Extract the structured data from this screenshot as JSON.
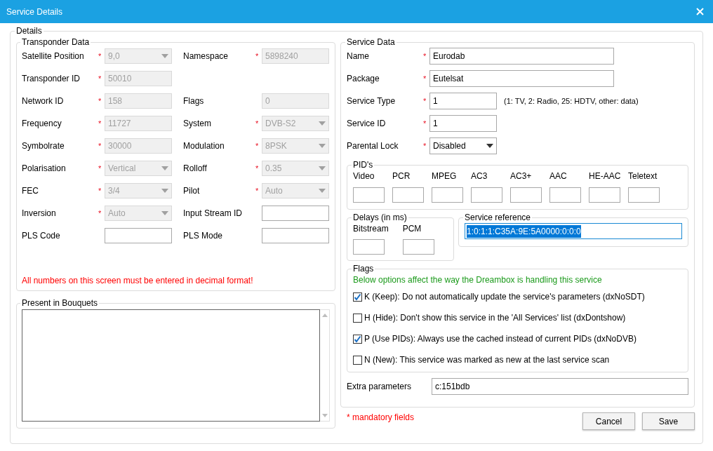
{
  "window": {
    "title": "Service Details"
  },
  "details": {
    "title": "Details",
    "transponder": {
      "title": "Transponder Data",
      "rows": [
        {
          "left": {
            "label": "Satellite Position",
            "required_mark": "*",
            "kind": "dropdown",
            "value": "9,0",
            "disabled": true
          },
          "right": {
            "label": "Namespace",
            "required_mark": "*",
            "kind": "text",
            "value": "5898240",
            "disabled": true
          }
        },
        {
          "left": {
            "label": "Transponder ID",
            "required_mark": "*",
            "kind": "text",
            "value": "50010",
            "disabled": true
          }
        },
        {
          "left": {
            "label": "Network ID",
            "required_mark": "*",
            "kind": "text",
            "value": "158",
            "disabled": true
          },
          "right": {
            "label": "Flags",
            "kind": "text",
            "value": "0",
            "disabled": true
          }
        },
        {
          "left": {
            "label": "Frequency",
            "required_mark": "*",
            "kind": "text",
            "value": "11727",
            "disabled": true
          },
          "right": {
            "label": "System",
            "required_mark": "*",
            "kind": "dropdown",
            "value": "DVB-S2",
            "disabled": true
          }
        },
        {
          "left": {
            "label": "Symbolrate",
            "required_mark": "*",
            "kind": "text",
            "value": "30000",
            "disabled": true
          },
          "right": {
            "label": "Modulation",
            "required_mark": "*",
            "kind": "dropdown",
            "value": "8PSK",
            "disabled": true
          }
        },
        {
          "left": {
            "label": "Polarisation",
            "required_mark": "*",
            "kind": "dropdown",
            "value": "Vertical",
            "disabled": true
          },
          "right": {
            "label": "Rolloff",
            "required_mark": "*",
            "kind": "dropdown",
            "value": "0.35",
            "disabled": true
          }
        },
        {
          "left": {
            "label": "FEC",
            "required_mark": "*",
            "kind": "dropdown",
            "value": "3/4",
            "disabled": true
          },
          "right": {
            "label": "Pilot",
            "required_mark": "*",
            "kind": "dropdown",
            "value": "Auto",
            "disabled": true
          }
        },
        {
          "left": {
            "label": "Inversion",
            "required_mark": "*",
            "kind": "dropdown",
            "value": "Auto",
            "disabled": true
          },
          "right": {
            "label": "Input Stream ID",
            "kind": "text",
            "disabled": false
          }
        },
        {
          "left": {
            "label": "PLS Code",
            "kind": "text",
            "disabled": false
          },
          "right": {
            "label": "PLS Mode",
            "kind": "text",
            "disabled": false
          }
        }
      ],
      "note": "All numbers on this screen must be entered in decimal format!"
    },
    "bouquets": {
      "title": "Present in Bouquets"
    },
    "service": {
      "title": "Service Data",
      "fields": [
        {
          "label": "Name",
          "required_mark": "*",
          "kind": "long_text",
          "value": "Eurodab"
        },
        {
          "label": "Package",
          "required_mark": "*",
          "kind": "long_text",
          "value": "Eutelsat"
        },
        {
          "label": "Service Type",
          "required_mark": "*",
          "kind": "text",
          "value": "1",
          "hint": "(1: TV, 2: Radio, 25: HDTV, other: data)"
        },
        {
          "label": "Service ID",
          "required_mark": "*",
          "kind": "text",
          "value": "1"
        },
        {
          "label": "Parental Lock",
          "required_mark": "*",
          "kind": "dropdown",
          "value": "Disabled"
        }
      ],
      "pids": {
        "title": "PID's",
        "items": [
          {
            "label": "Video"
          },
          {
            "label": "PCR"
          },
          {
            "label": "MPEG"
          },
          {
            "label": "AC3"
          },
          {
            "label": "AC3+"
          },
          {
            "label": "AAC"
          },
          {
            "label": "HE-AAC"
          },
          {
            "label": "Teletext"
          }
        ]
      },
      "delays": {
        "title": "Delays (in ms)",
        "items": [
          {
            "label": "Bitstream"
          },
          {
            "label": "PCM"
          }
        ]
      },
      "reference": {
        "title": "Service reference",
        "value": "1:0:1:1:C35A:9E:5A0000:0:0:0",
        "selected": true
      },
      "flags": {
        "title": "Flags",
        "note": "Below options affect the way the Dreambox is handling this service",
        "items": [
          {
            "label": "K (Keep): Do not automatically update the service's parameters (dxNoSDT)",
            "checked": true
          },
          {
            "label": "H (Hide): Don't show this service in the 'All Services' list (dxDontshow)",
            "checked": false
          },
          {
            "label": "P (Use PIDs): Always use the cached instead of current PIDs (dxNoDVB)",
            "checked": true
          },
          {
            "label": "N (New): This service was marked as new at the last service scan",
            "checked": false
          }
        ]
      },
      "extra": {
        "label": "Extra parameters",
        "value": "c:151bdb"
      }
    },
    "mandatory_note": "* mandatory fields",
    "buttons": [
      {
        "label": "Cancel"
      },
      {
        "label": "Save"
      }
    ]
  }
}
